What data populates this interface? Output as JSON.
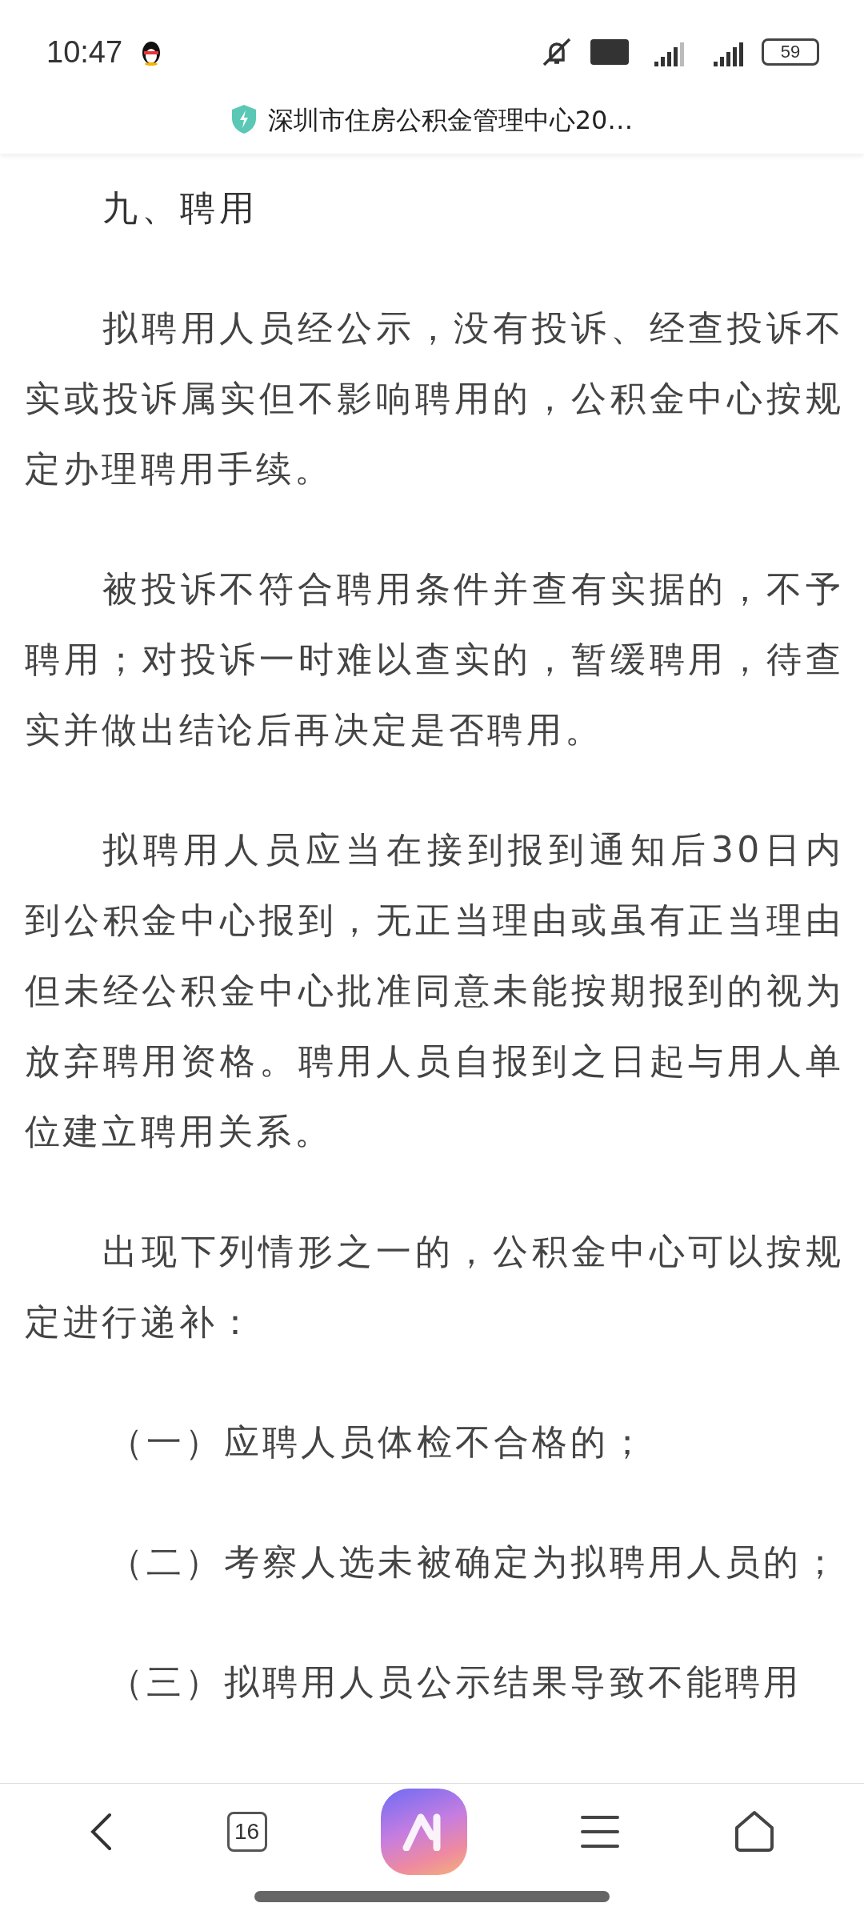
{
  "status_bar": {
    "time": "10:47",
    "battery": "59"
  },
  "title_bar": {
    "title": "深圳市住房公积金管理中心20…"
  },
  "article": [
    {
      "kind": "heading",
      "text": "九、聘用"
    },
    {
      "kind": "paragraph",
      "text": "拟聘用人员经公示，没有投诉、经查投诉不实或投诉属实但不影响聘用的，公积金中心按规定办理聘用手续。"
    },
    {
      "kind": "paragraph",
      "text": "被投诉不符合聘用条件并查有实据的，不予聘用；对投诉一时难以查实的，暂缓聘用，待查实并做出结论后再决定是否聘用。"
    },
    {
      "kind": "paragraph",
      "text": "拟聘用人员应当在接到报到通知后30日内到公积金中心报到，无正当理由或虽有正当理由但未经公积金中心批准同意未能按期报到的视为放弃聘用资格。聘用人员自报到之日起与用人单位建立聘用关系。"
    },
    {
      "kind": "paragraph",
      "text": "出现下列情形之一的，公积金中心可以按规定进行递补："
    },
    {
      "kind": "item",
      "text": "（一）应聘人员体检不合格的；"
    },
    {
      "kind": "item",
      "text": "（二）考察人选未被确定为拟聘用人员的；"
    },
    {
      "kind": "item",
      "text": "（三）拟聘用人员公示结果导致不能聘用"
    }
  ],
  "bottom_nav": {
    "tab_count": "16"
  }
}
